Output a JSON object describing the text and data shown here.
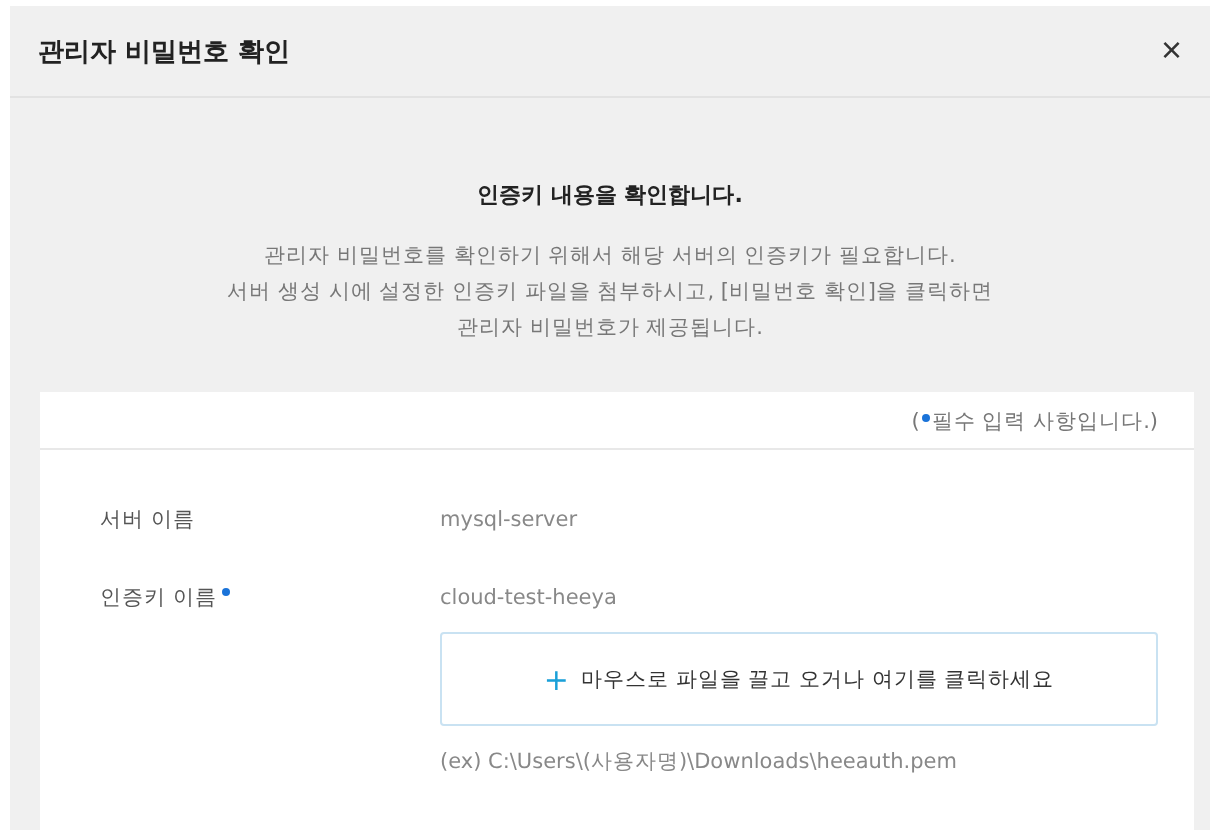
{
  "dialog": {
    "title": "관리자 비밀번호 확인",
    "close": "×"
  },
  "intro": {
    "heading": "인증키 내용을 확인합니다.",
    "lines": [
      "관리자 비밀번호를 확인하기 위해서 해당 서버의 인증키가 필요합니다.",
      "서버 생성 시에 설정한 인증키 파일을 첨부하시고, [비밀번호 확인]을 클릭하면",
      "관리자 비밀번호가 제공됩니다."
    ]
  },
  "required_note": {
    "open": "(",
    "text": "필수 입력 사항입니다.)"
  },
  "fields": [
    {
      "label": "서버 이름",
      "required": false,
      "value": "mysql-server"
    },
    {
      "label": "인증키 이름",
      "required": true,
      "value": "cloud-test-heeya"
    }
  ],
  "dropzone": {
    "icon": "+",
    "text": "마우스로 파일을 끌고 오거나 여기를 클릭하세요"
  },
  "example_path": "(ex) C:\\Users\\(사용자명)\\Downloads\\heeauth.pem"
}
